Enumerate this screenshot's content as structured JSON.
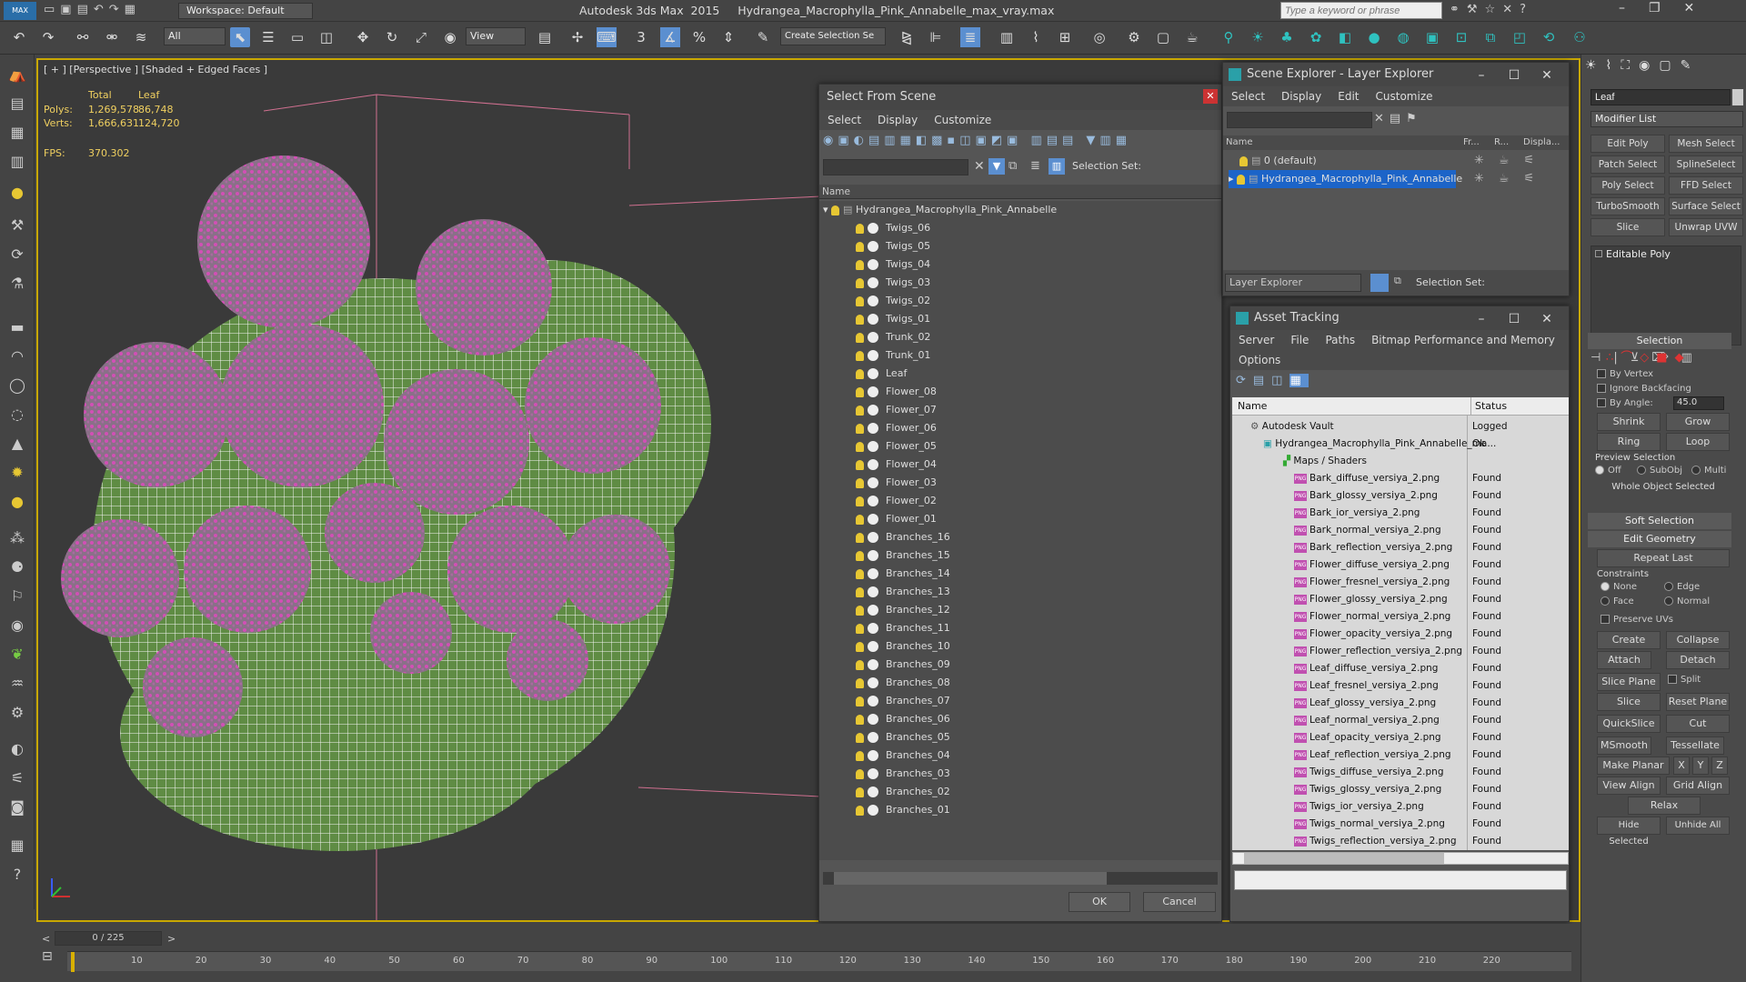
{
  "app": {
    "title": "Autodesk 3ds Max  2015     Hydrangea_Macrophylla_Pink_Annabelle_max_vray.max",
    "workspace_label": "Workspace: Default",
    "search_placeholder": "Type a keyword or phrase"
  },
  "toolbar": {
    "filter_value": "All",
    "coord_value": "View",
    "snap_label": "3",
    "selection_set_value": "Create Selection Se"
  },
  "viewport": {
    "label": "[ + ] [Perspective ] [Shaded + Edged Faces ]",
    "stats": {
      "total_label": "Total",
      "leaf_label": "Leaf",
      "polys_label": "Polys:",
      "polys_total": "1,269,578",
      "polys_leaf": "86,748",
      "verts_label": "Verts:",
      "verts_total": "1,666,631",
      "verts_leaf": "124,720",
      "fps_label": "FPS:",
      "fps_value": "370.302"
    }
  },
  "select_from_scene": {
    "title": "Select From Scene",
    "menu": [
      "Select",
      "Display",
      "Customize"
    ],
    "selection_set_label": "Selection Set:",
    "column_name": "Name",
    "root": "Hydrangea_Macrophylla_Pink_Annabelle",
    "items": [
      "Twigs_06",
      "Twigs_05",
      "Twigs_04",
      "Twigs_03",
      "Twigs_02",
      "Twigs_01",
      "Trunk_02",
      "Trunk_01",
      "Leaf",
      "Flower_08",
      "Flower_07",
      "Flower_06",
      "Flower_05",
      "Flower_04",
      "Flower_03",
      "Flower_02",
      "Flower_01",
      "Branches_16",
      "Branches_15",
      "Branches_14",
      "Branches_13",
      "Branches_12",
      "Branches_11",
      "Branches_10",
      "Branches_09",
      "Branches_08",
      "Branches_07",
      "Branches_06",
      "Branches_05",
      "Branches_04",
      "Branches_03",
      "Branches_02",
      "Branches_01"
    ],
    "ok_label": "OK",
    "cancel_label": "Cancel"
  },
  "scene_explorer": {
    "title": "Scene Explorer - Layer Explorer",
    "menu": [
      "Select",
      "Display",
      "Edit",
      "Customize"
    ],
    "columns": [
      "Name",
      "Fr...",
      "R...",
      "Displa..."
    ],
    "layers": [
      "0 (default)",
      "Hydrangea_Macrophylla_Pink_Annabelle"
    ],
    "footer_dropdown": "Layer Explorer",
    "selection_set_label": "Selection Set:"
  },
  "asset_tracking": {
    "title": "Asset Tracking",
    "menu": [
      "Server",
      "File",
      "Paths",
      "Bitmap Performance and Memory"
    ],
    "menu2": "Options",
    "col_name": "Name",
    "col_status": "Status",
    "vault": {
      "name": "Autodesk Vault",
      "status": "Logged"
    },
    "file": {
      "name": "Hydrangea_Macrophylla_Pink_Annabelle_ma...",
      "status": "Ok"
    },
    "maps_label": "Maps / Shaders",
    "maps": [
      {
        "name": "Bark_diffuse_versiya_2.png",
        "status": "Found"
      },
      {
        "name": "Bark_glossy_versiya_2.png",
        "status": "Found"
      },
      {
        "name": "Bark_ior_versiya_2.png",
        "status": "Found"
      },
      {
        "name": "Bark_normal_versiya_2.png",
        "status": "Found"
      },
      {
        "name": "Bark_reflection_versiya_2.png",
        "status": "Found"
      },
      {
        "name": "Flower_diffuse_versiya_2.png",
        "status": "Found"
      },
      {
        "name": "Flower_fresnel_versiya_2.png",
        "status": "Found"
      },
      {
        "name": "Flower_glossy_versiya_2.png",
        "status": "Found"
      },
      {
        "name": "Flower_normal_versiya_2.png",
        "status": "Found"
      },
      {
        "name": "Flower_opacity_versiya_2.png",
        "status": "Found"
      },
      {
        "name": "Flower_reflection_versiya_2.png",
        "status": "Found"
      },
      {
        "name": "Leaf_diffuse_versiya_2.png",
        "status": "Found"
      },
      {
        "name": "Leaf_fresnel_versiya_2.png",
        "status": "Found"
      },
      {
        "name": "Leaf_glossy_versiya_2.png",
        "status": "Found"
      },
      {
        "name": "Leaf_normal_versiya_2.png",
        "status": "Found"
      },
      {
        "name": "Leaf_opacity_versiya_2.png",
        "status": "Found"
      },
      {
        "name": "Leaf_reflection_versiya_2.png",
        "status": "Found"
      },
      {
        "name": "Twigs_diffuse_versiya_2.png",
        "status": "Found"
      },
      {
        "name": "Twigs_glossy_versiya_2.png",
        "status": "Found"
      },
      {
        "name": "Twigs_ior_versiya_2.png",
        "status": "Found"
      },
      {
        "name": "Twigs_normal_versiya_2.png",
        "status": "Found"
      },
      {
        "name": "Twigs_reflection_versiya_2.png",
        "status": "Found"
      }
    ]
  },
  "command_panel": {
    "object_name": "Leaf",
    "modifier_list": "Modifier List",
    "modifier_buttons": [
      "Edit Poly",
      "Mesh Select",
      "Patch Select",
      "SplineSelect",
      "Poly Select",
      "FFD Select",
      "TurboSmooth",
      "Surface Select",
      "Slice",
      "Unwrap UVW"
    ],
    "stack_item": "Editable Poly",
    "selection_header": "Selection",
    "by_vertex": "By Vertex",
    "ignore_backfacing": "Ignore Backfacing",
    "by_angle": "By Angle:",
    "angle_value": "45.0",
    "shrink": "Shrink",
    "grow": "Grow",
    "ring": "Ring",
    "loop": "Loop",
    "preview_selection": "Preview Selection",
    "preview_off": "Off",
    "preview_subobj": "SubObj",
    "preview_multi": "Multi",
    "whole_object": "Whole Object Selected",
    "soft_selection": "Soft Selection",
    "edit_geometry": "Edit Geometry",
    "repeat_last": "Repeat Last",
    "constraints": "Constraints",
    "c_none": "None",
    "c_edge": "Edge",
    "c_face": "Face",
    "c_normal": "Normal",
    "preserve_uvs": "Preserve UVs",
    "create": "Create",
    "collapse": "Collapse",
    "attach": "Attach",
    "detach": "Detach",
    "slice_plane": "Slice Plane",
    "split": "Split",
    "slice": "Slice",
    "reset_plane": "Reset Plane",
    "quickslice": "QuickSlice",
    "cut": "Cut",
    "msmooth": "MSmooth",
    "tessellate": "Tessellate",
    "make_planar": "Make Planar",
    "x": "X",
    "y": "Y",
    "z": "Z",
    "view_align": "View Align",
    "grid_align": "Grid Align",
    "relax": "Relax",
    "hide_selected": "Hide Selected",
    "unhide_all": "Unhide All"
  },
  "timeline": {
    "frame_counter": "0 / 225",
    "ticks": [
      "10",
      "20",
      "30",
      "40",
      "50",
      "60",
      "70",
      "80",
      "90",
      "100",
      "110",
      "120",
      "130",
      "140",
      "150",
      "160",
      "170",
      "180",
      "190",
      "200",
      "210",
      "220"
    ]
  },
  "colors": {
    "viewport_border": "#c9a800",
    "selection_highlight": "#1c64c8",
    "flower": "#c050a8",
    "leaf": "#5f8c44"
  }
}
